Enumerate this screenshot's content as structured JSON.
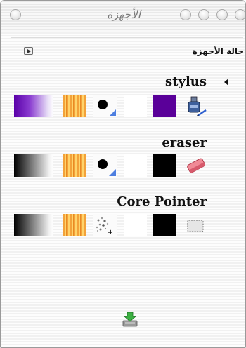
{
  "window": {
    "title": "الأجهزة",
    "buttons": [
      "close",
      "minimize",
      "zoom",
      "shade"
    ]
  },
  "header": {
    "label": "حالة الأجهزة",
    "menu_icon": "play-triangle-icon"
  },
  "devices": [
    {
      "name": "stylus",
      "expanded_indicator": "triangle-left-icon",
      "gradient_color": "#6a00b8",
      "cursor": "dot",
      "solid_color": "#5a0099",
      "icon": "stylus-ink-icon"
    },
    {
      "name": "eraser",
      "gradient_color": "#000000",
      "cursor": "dot",
      "solid_color": "#000000",
      "icon": "eraser-icon"
    },
    {
      "name": "Core Pointer",
      "gradient_color": "#000000",
      "cursor": "sparkle",
      "solid_color": "#000000",
      "icon": "pointer-device-icon"
    }
  ],
  "footer": {
    "save_icon": "save-download-icon"
  }
}
